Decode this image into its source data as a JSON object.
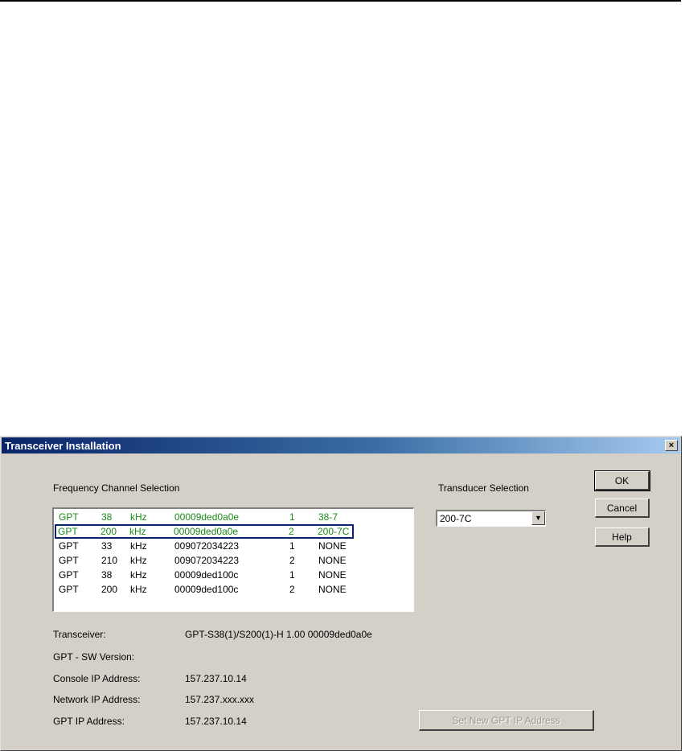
{
  "dialog": {
    "title": "Transceiver Installation",
    "close_label": "×"
  },
  "frequency": {
    "heading": "Frequency Channel Selection",
    "rows": [
      {
        "type": "GPT",
        "freq": "38",
        "unit": "kHz",
        "serial": "00009ded0a0e",
        "channel": "1",
        "transducer": "38-7",
        "highlight": "green"
      },
      {
        "type": "GPT",
        "freq": "200",
        "unit": "kHz",
        "serial": "00009ded0a0e",
        "channel": "2",
        "transducer": "200-7C",
        "highlight": "green-selected"
      },
      {
        "type": "GPT",
        "freq": "33",
        "unit": "kHz",
        "serial": "009072034223",
        "channel": "1",
        "transducer": "NONE",
        "highlight": "none"
      },
      {
        "type": "GPT",
        "freq": "210",
        "unit": "kHz",
        "serial": "009072034223",
        "channel": "2",
        "transducer": "NONE",
        "highlight": "none"
      },
      {
        "type": "GPT",
        "freq": "38",
        "unit": "kHz",
        "serial": "00009ded100c",
        "channel": "1",
        "transducer": "NONE",
        "highlight": "none"
      },
      {
        "type": "GPT",
        "freq": "200",
        "unit": "kHz",
        "serial": "00009ded100c",
        "channel": "2",
        "transducer": "NONE",
        "highlight": "none"
      }
    ]
  },
  "transducer": {
    "heading": "Transducer Selection",
    "selected": "200-7C"
  },
  "buttons": {
    "ok": "OK",
    "cancel": "Cancel",
    "help": "Help",
    "set_ip": "Set New GPT IP Address"
  },
  "info": {
    "transceiver_label": "Transceiver:",
    "transceiver_value": "GPT-S38(1)/S200(1)-H 1.00 00009ded0a0e",
    "sw_version_label": "GPT - SW Version:",
    "console_ip_label": "Console IP Address:",
    "console_ip_value": "157.237.10.14",
    "network_ip_label": "Network IP Address:",
    "network_ip_value": "157.237.xxx.xxx",
    "gpt_ip_label": "GPT IP Address:",
    "gpt_ip_value": "157.237.10.14"
  },
  "colors": {
    "title_bar": "#0a246a",
    "active_channel_text": "#1a8a1a"
  }
}
